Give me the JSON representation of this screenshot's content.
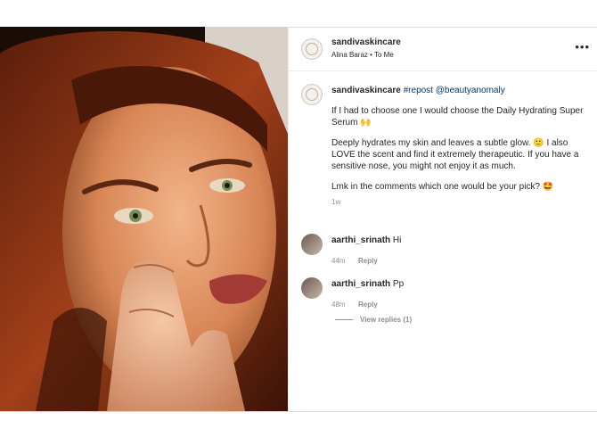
{
  "post": {
    "author": "sandivaskincare",
    "subtitle": "Alina Baraz • To Me",
    "more_icon": "more-horizontal-icon"
  },
  "caption": {
    "author": "sandivaskincare",
    "repost_text": "#repost @beautyanomaly",
    "para1": "If I had to choose one I would choose the Daily Hydrating Super Serum",
    "para2": "Deeply hydrates my skin and leaves a subtle glow. 🙂 I also LOVE the scent and find it extremely therapeutic. If you have a sensitive nose, you might not enjoy it as much.",
    "para3": "Lmk in the comments which one would be your pick? 🤩",
    "time": "1w"
  },
  "comments": [
    {
      "user": "aarthi_srinath",
      "text": "Hi",
      "time": "44m",
      "reply_label": "Reply"
    },
    {
      "user": "aarthi_srinath",
      "text": "Pp",
      "time": "48m",
      "reply_label": "Reply"
    }
  ],
  "view_replies": "View replies (1)",
  "colors": {
    "link": "#00376b",
    "muted": "#8e8e8e",
    "text": "#262626"
  }
}
